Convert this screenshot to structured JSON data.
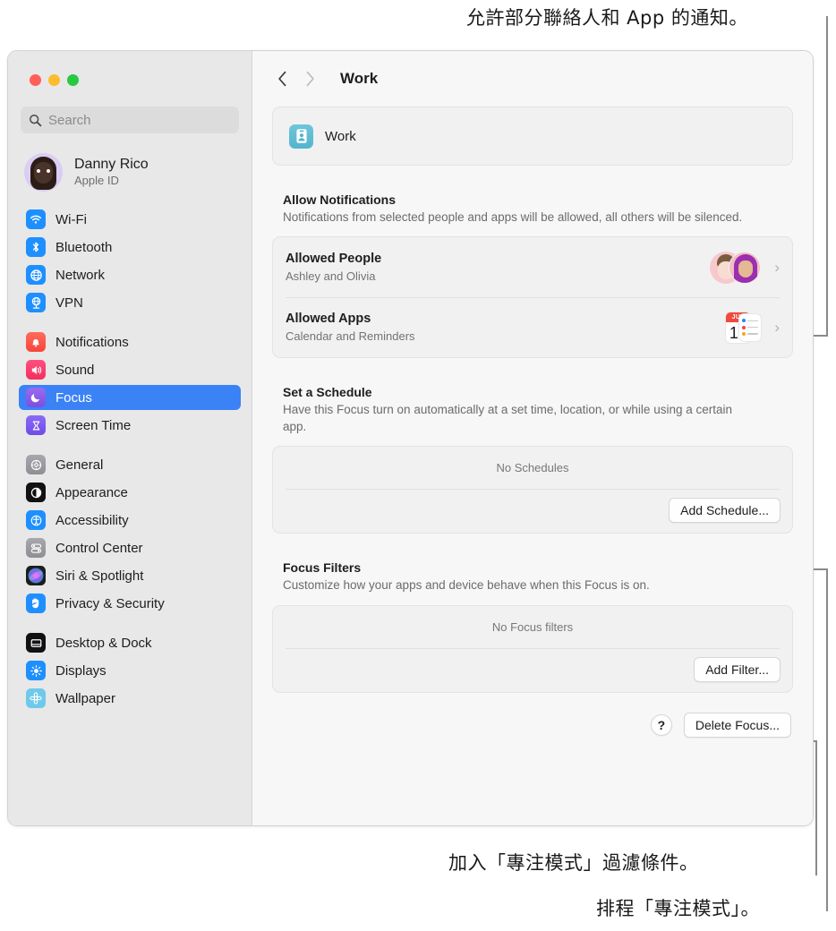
{
  "callouts": {
    "top": {
      "text": "允許部分聯絡人和 App 的通知。"
    },
    "filters": {
      "text": "加入「專注模式」過濾條件。"
    },
    "schedule": {
      "text": "排程「專注模式」。"
    }
  },
  "window": {
    "traffic_lights": [
      "close",
      "minimize",
      "zoom"
    ],
    "colors": {
      "close": "#ff5f57",
      "minimize": "#febc2e",
      "zoom": "#28c840",
      "accent": "#3b82f6"
    }
  },
  "sidebar": {
    "search": {
      "placeholder": "Search",
      "value": "",
      "icon": "search-icon"
    },
    "account": {
      "name": "Danny Rico",
      "subtitle": "Apple ID",
      "avatar": "memoji-avatar"
    },
    "groups": [
      {
        "items": [
          {
            "label": "Wi-Fi",
            "icon": "wifi-icon",
            "selected": false
          },
          {
            "label": "Bluetooth",
            "icon": "bluetooth-icon",
            "selected": false
          },
          {
            "label": "Network",
            "icon": "network-globe-icon",
            "selected": false
          },
          {
            "label": "VPN",
            "icon": "vpn-icon",
            "selected": false
          }
        ]
      },
      {
        "items": [
          {
            "label": "Notifications",
            "icon": "notifications-bell-icon",
            "selected": false
          },
          {
            "label": "Sound",
            "icon": "sound-speaker-icon",
            "selected": false
          },
          {
            "label": "Focus",
            "icon": "focus-moon-icon",
            "selected": true
          },
          {
            "label": "Screen Time",
            "icon": "screen-time-hourglass-icon",
            "selected": false
          }
        ]
      },
      {
        "items": [
          {
            "label": "General",
            "icon": "general-gear-icon",
            "selected": false
          },
          {
            "label": "Appearance",
            "icon": "appearance-contrast-icon",
            "selected": false
          },
          {
            "label": "Accessibility",
            "icon": "accessibility-icon",
            "selected": false
          },
          {
            "label": "Control Center",
            "icon": "control-center-icon",
            "selected": false
          },
          {
            "label": "Siri & Spotlight",
            "icon": "siri-icon",
            "selected": false
          },
          {
            "label": "Privacy & Security",
            "icon": "privacy-hand-icon",
            "selected": false
          }
        ]
      },
      {
        "items": [
          {
            "label": "Desktop & Dock",
            "icon": "desktop-dock-icon",
            "selected": false
          },
          {
            "label": "Displays",
            "icon": "displays-brightness-icon",
            "selected": false
          },
          {
            "label": "Wallpaper",
            "icon": "wallpaper-flower-icon",
            "selected": false
          }
        ]
      }
    ]
  },
  "main": {
    "toolbar": {
      "back_icon": "chevron-left-icon",
      "forward_icon": "chevron-right-icon",
      "title": "Work"
    },
    "focus_header": {
      "name": "Work",
      "icon": "work-badge-icon"
    },
    "allow_notifications": {
      "title": "Allow Notifications",
      "description": "Notifications from selected people and apps will be allowed, all others will be silenced.",
      "rows": [
        {
          "title": "Allowed People",
          "subtitle": "Ashley and Olivia",
          "accessory": "people-avatars",
          "disclosure": "›"
        },
        {
          "title": "Allowed Apps",
          "subtitle": "Calendar and Reminders",
          "accessory": "calendar-reminders-icons",
          "disclosure": "›"
        }
      ]
    },
    "schedule": {
      "title": "Set a Schedule",
      "description": "Have this Focus turn on automatically at a set time, location, or while using a certain app.",
      "empty_label": "No Schedules",
      "button": "Add Schedule..."
    },
    "focus_filters": {
      "title": "Focus Filters",
      "description": "Customize how your apps and device behave when this Focus is on.",
      "empty_label": "No Focus filters",
      "button": "Add Filter..."
    },
    "footer": {
      "help_label": "?",
      "delete_button": "Delete Focus..."
    },
    "calendar_icon": {
      "month": "JUL",
      "day": "17"
    }
  }
}
